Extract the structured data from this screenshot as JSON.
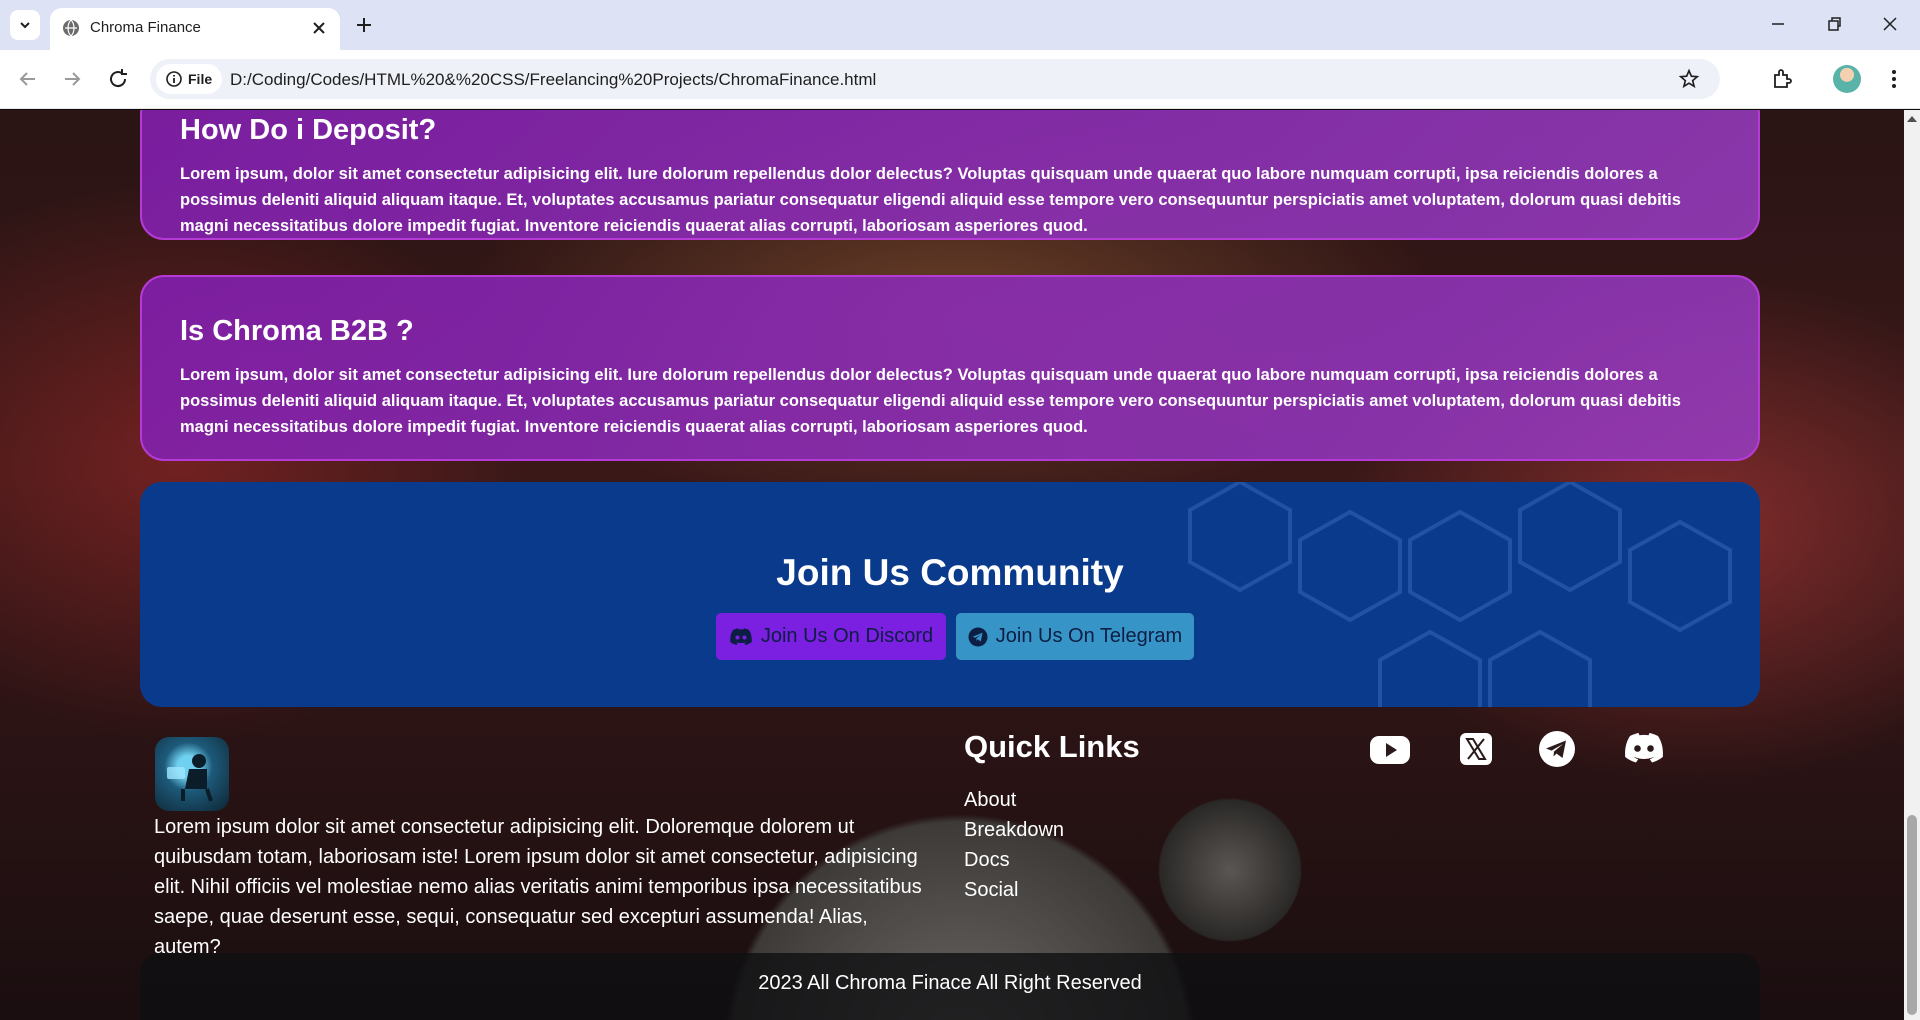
{
  "browser": {
    "tab_title": "Chroma Finance",
    "site_chip": "File",
    "url": "D:/Coding/Codes/HTML%20&%20CSS/Freelancing%20Projects/ChromaFinance.html"
  },
  "faq": [
    {
      "question": "How Do i Deposit?",
      "answer": "Lorem ipsum, dolor sit amet consectetur adipisicing elit. Iure dolorum repellendus dolor delectus? Voluptas quisquam unde quaerat quo labore numquam corrupti, ipsa reiciendis dolores a possimus deleniti aliquid aliquam itaque. Et, voluptates accusamus pariatur consequatur eligendi aliquid esse tempore vero consequuntur perspiciatis amet voluptatem, dolorum quasi debitis magni necessitatibus dolore impedit fugiat. Inventore reiciendis quaerat alias corrupti, laboriosam asperiores quod."
    },
    {
      "question": "Is Chroma B2B ?",
      "answer": "Lorem ipsum, dolor sit amet consectetur adipisicing elit. Iure dolorum repellendus dolor delectus? Voluptas quisquam unde quaerat quo labore numquam corrupti, ipsa reiciendis dolores a possimus deleniti aliquid aliquam itaque. Et, voluptates accusamus pariatur consequatur eligendi aliquid esse tempore vero consequuntur perspiciatis amet voluptatem, dolorum quasi debitis magni necessitatibus dolore impedit fugiat. Inventore reiciendis quaerat alias corrupti, laboriosam asperiores quod."
    }
  ],
  "community": {
    "title": "Join Us Community",
    "discord_label": "Join Us On Discord",
    "telegram_label": "Join Us On Telegram"
  },
  "footer": {
    "description": "Lorem ipsum dolor sit amet consectetur adipisicing elit. Doloremque dolorem ut quibusdam totam, laboriosam iste! Lorem ipsum dolor sit amet consectetur, adipisicing elit. Nihil officiis vel molestiae nemo alias veritatis animi temporibus ipsa necessitatibus saepe, quae deserunt esse, sequi, consequatur sed excepturi assumenda! Alias, autem?",
    "quick_links_title": "Quick Links",
    "quick_links": [
      "About",
      "Breakdown",
      "Docs",
      "Social"
    ],
    "social_icons": [
      "youtube-icon",
      "x-icon",
      "telegram-icon",
      "discord-icon"
    ],
    "copyright": "2023 All Chroma Finace All Right Reserved"
  },
  "colors": {
    "faq_card": "#8a24b8",
    "community_bg": "#0a3a8c",
    "discord_button": "#7b1fe0",
    "telegram_button": "#3794c6"
  }
}
